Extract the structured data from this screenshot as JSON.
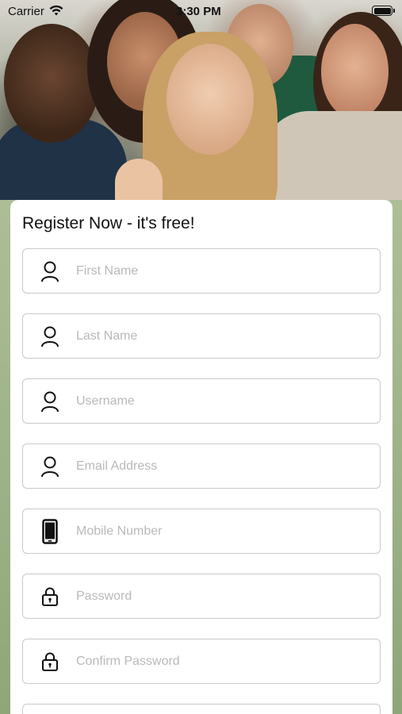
{
  "status_bar": {
    "carrier": "Carrier",
    "time": "3:30 PM"
  },
  "form": {
    "title": "Register Now - it's free!",
    "fields": [
      {
        "placeholder": "First Name",
        "icon": "person-icon"
      },
      {
        "placeholder": "Last Name",
        "icon": "person-icon"
      },
      {
        "placeholder": "Username",
        "icon": "person-icon"
      },
      {
        "placeholder": "Email Address",
        "icon": "person-icon"
      },
      {
        "placeholder": "Mobile Number",
        "icon": "phone-icon"
      },
      {
        "placeholder": "Password",
        "icon": "lock-icon"
      },
      {
        "placeholder": "Confirm Password",
        "icon": "lock-icon"
      },
      {
        "placeholder": "",
        "icon": ""
      }
    ]
  },
  "colors": {
    "card": "#ffffff",
    "field_border": "#c9c9c9",
    "placeholder": "#b9b9b9",
    "background_top": "#b9c6a4",
    "background_bottom": "#8ea67a"
  }
}
